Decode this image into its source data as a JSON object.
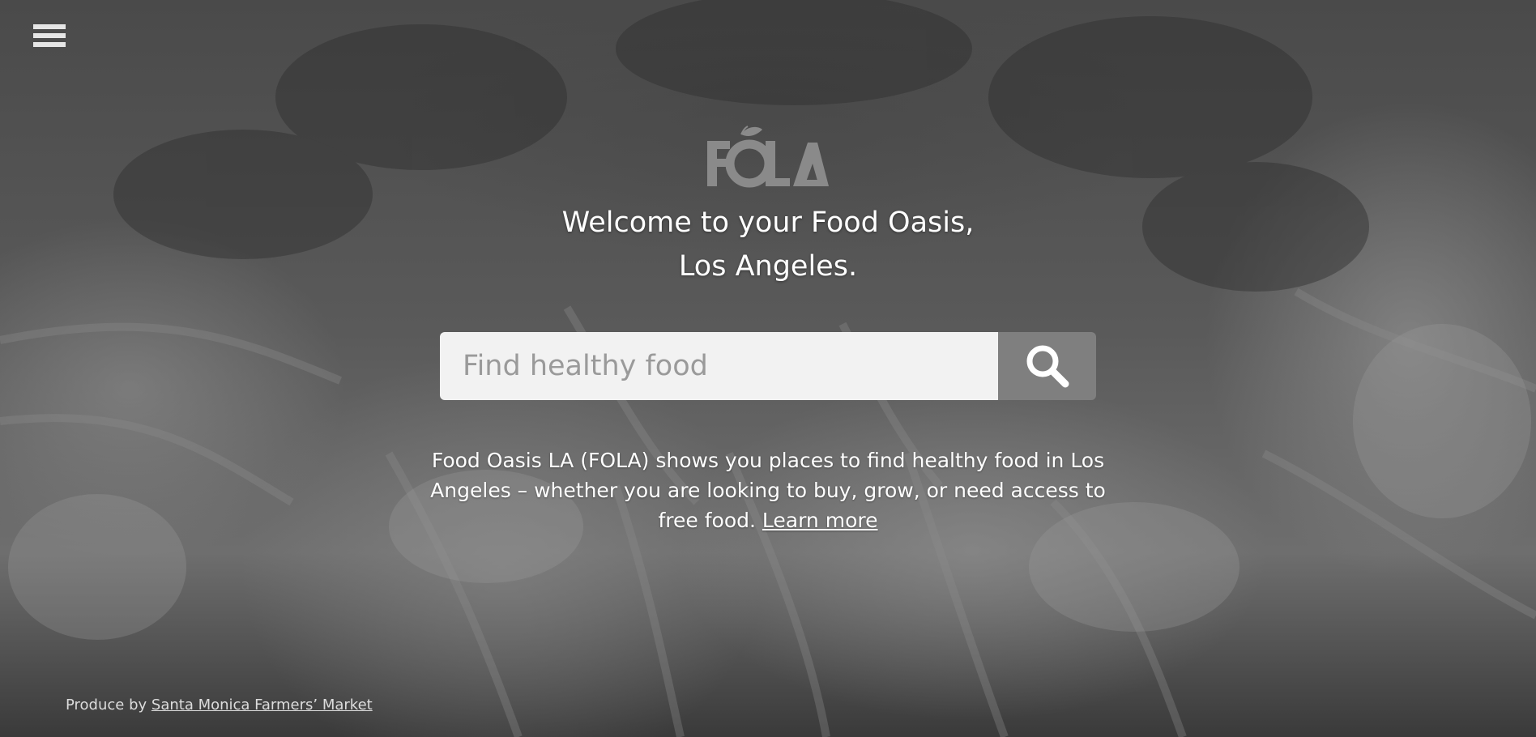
{
  "background": {
    "description_icon": "produce-photo-background",
    "tone": "#5a5a5a"
  },
  "menu": {
    "icon": "hamburger-menu-icon"
  },
  "logo": {
    "text": "FOLA",
    "icon": "leaf-icon"
  },
  "headline": {
    "line1": "Welcome to your Food Oasis,",
    "line2": "Los Angeles."
  },
  "search": {
    "placeholder": "Find healthy food",
    "value": "",
    "button_icon": "search-icon",
    "button_color": "#7f7f7f"
  },
  "description": {
    "text": "Food Oasis LA (FOLA) shows you places to find healthy food in Los Angeles – whether you are looking to buy, grow, or need access to free food.",
    "link_label": "Learn more"
  },
  "credit": {
    "prefix": "Produce by",
    "link_label": "Santa Monica Farmers’ Market"
  }
}
